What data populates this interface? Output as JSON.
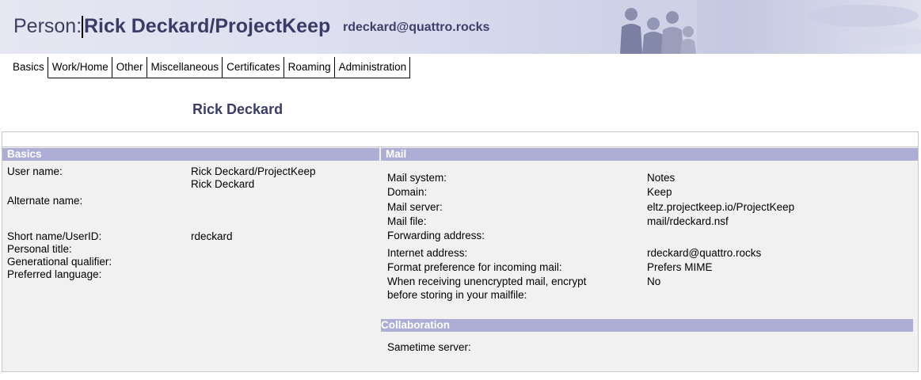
{
  "header": {
    "prefix": "Person:",
    "person_name": "Rick Deckard/ProjectKeep",
    "email": "rdeckard@quattro.rocks"
  },
  "tabs": [
    {
      "label": "Basics",
      "active": true
    },
    {
      "label": "Work/Home",
      "active": false
    },
    {
      "label": "Other",
      "active": false
    },
    {
      "label": "Miscellaneous",
      "active": false
    },
    {
      "label": "Certificates",
      "active": false
    },
    {
      "label": "Roaming",
      "active": false
    },
    {
      "label": "Administration",
      "active": false
    }
  ],
  "display_name": "Rick Deckard",
  "basics": {
    "title": "Basics",
    "user_name_label": "User name:",
    "user_name_value_1": "Rick Deckard/ProjectKeep",
    "user_name_value_2": "Rick Deckard",
    "alternate_name_label": "Alternate name:",
    "short_name_label": "Short name/UserID:",
    "short_name_value": "rdeckard",
    "personal_title_label": "Personal title:",
    "generational_qualifier_label": "Generational qualifier:",
    "preferred_language_label": "Preferred language:"
  },
  "mail": {
    "title": "Mail",
    "mail_system_label": "Mail system:",
    "mail_system_value": "Notes",
    "domain_label": "Domain:",
    "domain_value": "Keep",
    "mail_server_label": "Mail server:",
    "mail_server_value": "eltz.projectkeep.io/ProjectKeep",
    "mail_file_label": "Mail file:",
    "mail_file_value": "mail/rdeckard.nsf",
    "forwarding_label": "Forwarding address:",
    "internet_address_label": "Internet address:",
    "internet_address_value": "rdeckard@quattro.rocks",
    "format_pref_label": "Format preference for incoming mail:",
    "format_pref_value": "Prefers MIME",
    "encrypt_label_1": "When receiving unencrypted mail, encrypt",
    "encrypt_label_2": "before storing in your mailfile:",
    "encrypt_value": "No"
  },
  "collaboration": {
    "title": "Collaboration",
    "sametime_label": "Sametime server:"
  },
  "colors": {
    "section_header_bg": "#adadd6",
    "title_text": "#3a3c68"
  }
}
